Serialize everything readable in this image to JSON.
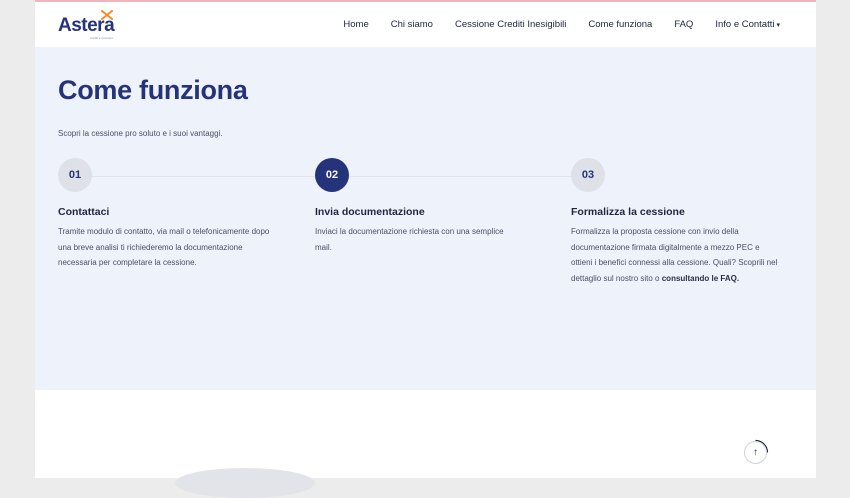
{
  "brand": {
    "name": "Astera",
    "tagline": "crediti e recupero"
  },
  "nav": {
    "items": [
      "Home",
      "Chi siamo",
      "Cessione Crediti Inesigibili",
      "Come funziona",
      "FAQ",
      "Info e Contatti"
    ],
    "dropdown_caret": "▾"
  },
  "hero": {
    "title": "Come funziona",
    "subtitle": "Scopri la cessione pro soluto e i suoi vantaggi."
  },
  "steps": [
    {
      "number": "01",
      "title": "Contattaci",
      "text": "Tramite modulo di contatto, via mail o telefonicamente dopo una breve analisi ti richiederemo la documentazione necessaria per completare la cessione."
    },
    {
      "number": "02",
      "title": "Invia documentazione",
      "text": "Inviaci la documentazione richiesta con una semplice mail."
    },
    {
      "number": "03",
      "title": "Formalizza la cessione",
      "text": "Formalizza la proposta cessione con invio della documentazione firmata digitalmente a mezzo PEC e ottieni i benefici connessi alla cessione. Quali? Scoprili nel dettaglio sul nostro sito o",
      "link": "consultando le FAQ."
    }
  ],
  "scroll_top": {
    "icon": "arrow-up-icon",
    "glyph": "↑"
  },
  "colors": {
    "primary": "#25337a",
    "accent": "#f28c28",
    "hero_bg": "#eef2fb"
  }
}
